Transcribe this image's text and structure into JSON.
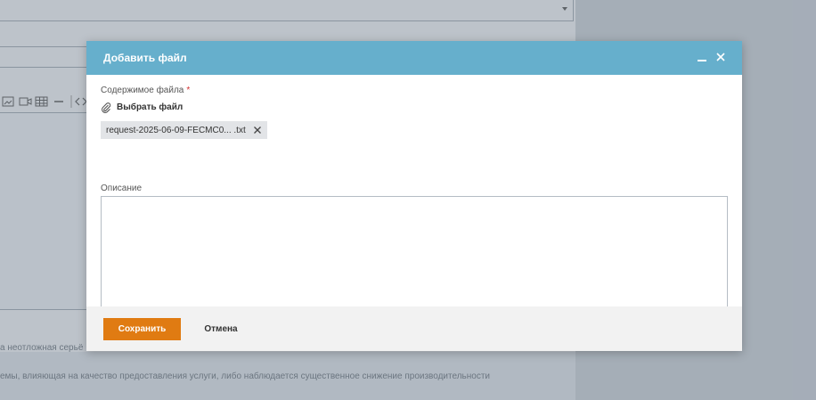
{
  "background": {
    "text_line_1": "а неотложная серьё",
    "text_line_2": "емы, влияющая на качество предоставления услуги, либо наблюдается существенное снижение производительности"
  },
  "modal": {
    "title": "Добавить файл",
    "file_content_label": "Содержимое файла",
    "required_mark": "*",
    "choose_file_label": "Выбрать файл",
    "attached_file_name": "request-2025-06-09-FECMC0... .txt",
    "description_label": "Описание",
    "description_value": "",
    "save_label": "Сохранить",
    "cancel_label": "Отмена"
  },
  "icons": {
    "minimize": "minimize-icon",
    "close": "close-icon",
    "attach": "paperclip-icon",
    "remove": "remove-file-icon"
  },
  "colors": {
    "header": "#66afcc",
    "save_button": "#e07b12",
    "footer": "#f2f2f2"
  }
}
